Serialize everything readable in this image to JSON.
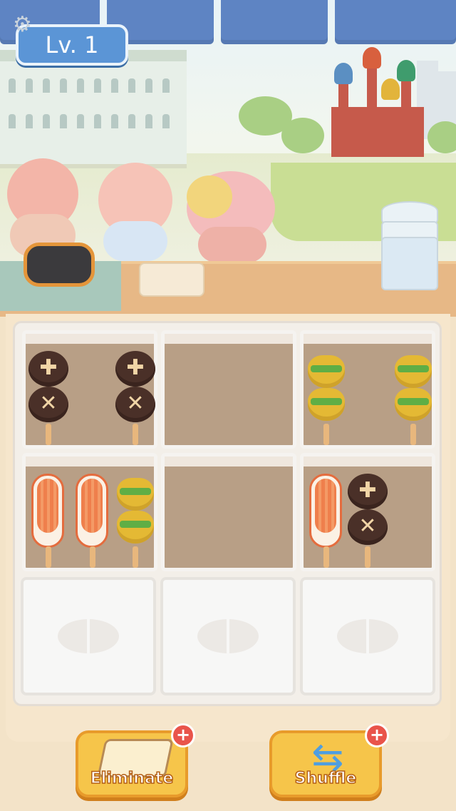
{
  "hud": {
    "level_label": "Lv. 1",
    "settings_icon": "gear-icon"
  },
  "scene": {
    "description_icons": [
      "palace-icon",
      "cathedral-icon"
    ]
  },
  "board": {
    "cells": [
      {
        "state": "active",
        "skewers": [
          "mushroom",
          "mushroom"
        ]
      },
      {
        "state": "active",
        "skewers": []
      },
      {
        "state": "active",
        "skewers": [
          "bean",
          "bean"
        ]
      },
      {
        "state": "active",
        "skewers": [
          "crab",
          "crab",
          "bean"
        ]
      },
      {
        "state": "active",
        "skewers": []
      },
      {
        "state": "active",
        "skewers": [
          "crab",
          "mushroom"
        ]
      },
      {
        "state": "locked",
        "skewers": []
      },
      {
        "state": "locked",
        "skewers": []
      },
      {
        "state": "locked",
        "skewers": []
      }
    ]
  },
  "buttons": {
    "eliminate": {
      "label": "Eliminate",
      "plus": "+"
    },
    "shuffle": {
      "label": "Shuffle",
      "plus": "+"
    }
  },
  "colors": {
    "accent": "#f6c54a",
    "level_badge": "#5b95d6",
    "plus_badge": "#e9544b"
  }
}
